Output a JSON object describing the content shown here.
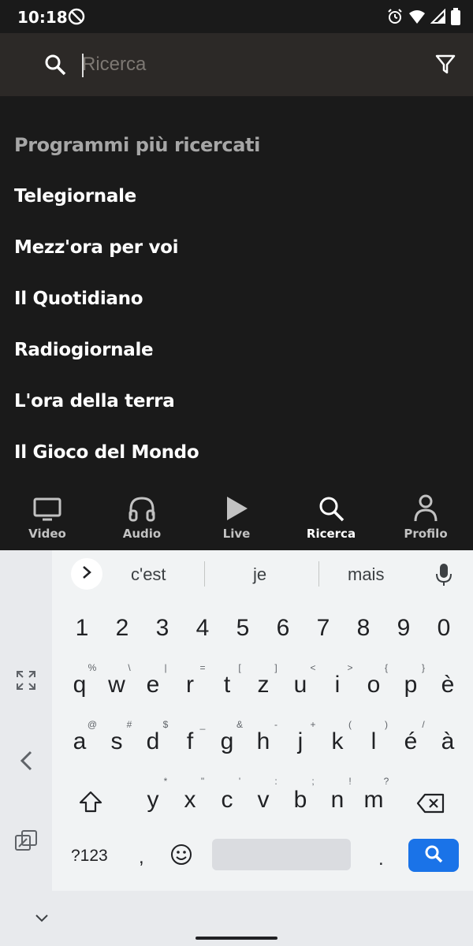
{
  "status_bar": {
    "time": "10:18"
  },
  "search": {
    "placeholder": "Ricerca",
    "value": ""
  },
  "section_title": "Programmi più ricercati",
  "programs": [
    "Telegiornale",
    "Mezz'ora per voi",
    "Il Quotidiano",
    "Radiogiornale",
    "L'ora della terra",
    "Il Gioco del Mondo"
  ],
  "bottom_nav": [
    {
      "label": "Video",
      "icon": "tv-icon"
    },
    {
      "label": "Audio",
      "icon": "headphones-icon"
    },
    {
      "label": "Live",
      "icon": "play-icon"
    },
    {
      "label": "Ricerca",
      "icon": "search-icon",
      "active": true
    },
    {
      "label": "Profilo",
      "icon": "person-icon"
    }
  ],
  "keyboard": {
    "suggestions": [
      "c'est",
      "je",
      "mais"
    ],
    "number_row": [
      "1",
      "2",
      "3",
      "4",
      "5",
      "6",
      "7",
      "8",
      "9",
      "0"
    ],
    "row1": [
      "q",
      "w",
      "e",
      "r",
      "t",
      "z",
      "u",
      "i",
      "o",
      "p",
      "è"
    ],
    "row1_hints": [
      "%",
      "\\",
      "|",
      "=",
      "[",
      "]",
      "<",
      ">",
      "{",
      "}",
      ""
    ],
    "row2": [
      "a",
      "s",
      "d",
      "f",
      "g",
      "h",
      "j",
      "k",
      "l",
      "é",
      "à"
    ],
    "row2_hints": [
      "@",
      "#",
      "$",
      "_",
      "&",
      "-",
      "+",
      "(",
      ")",
      "/",
      ""
    ],
    "row3": [
      "y",
      "x",
      "c",
      "v",
      "b",
      "n",
      "m"
    ],
    "row3_hints": [
      "*",
      "\"",
      "'",
      ":",
      ";",
      "!",
      "?"
    ],
    "symbols_label": "?123",
    "comma": ",",
    "period": "."
  },
  "colors": {
    "accent": "#1a73e8",
    "background": "#1a1a1a",
    "search_bar": "#2c2927"
  }
}
